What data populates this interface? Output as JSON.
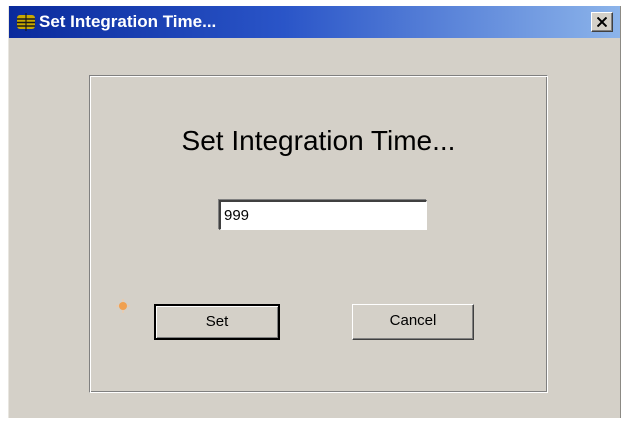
{
  "window": {
    "title": "Set Integration Time...",
    "icon": "app-icon",
    "close_icon": "close-icon"
  },
  "dialog": {
    "heading": "Set Integration Time...",
    "integration_time_value": "999",
    "set_button_label": "Set",
    "cancel_button_label": "Cancel",
    "indicator_icon": "status-dot-icon"
  },
  "colors": {
    "titlebar_start": "#0a2a9c",
    "titlebar_end": "#8cb4ea",
    "dialog_face": "#d4d0c8",
    "indicator": "#f0a050"
  }
}
